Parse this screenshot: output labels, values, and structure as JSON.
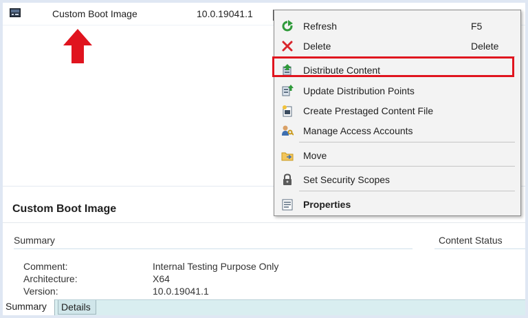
{
  "list": {
    "row": {
      "name": "Custom Boot Image",
      "version": "10.0.19041.1"
    }
  },
  "context_menu": {
    "items": [
      {
        "label": "Refresh",
        "shortcut": "F5",
        "icon": "refresh-icon"
      },
      {
        "label": "Delete",
        "shortcut": "Delete",
        "icon": "delete-icon"
      },
      {
        "label": "Distribute Content",
        "icon": "distribute-content-icon",
        "highlighted": true
      },
      {
        "label": "Update Distribution Points",
        "icon": "update-distribution-points-icon"
      },
      {
        "label": "Create Prestaged Content File",
        "icon": "prestaged-content-icon"
      },
      {
        "label": "Manage Access Accounts",
        "icon": "access-accounts-icon"
      },
      {
        "label": "Move",
        "icon": "folder-move-icon"
      },
      {
        "label": "Set Security Scopes",
        "icon": "lock-icon"
      },
      {
        "label": "Properties",
        "icon": "properties-icon"
      }
    ]
  },
  "details": {
    "title": "Custom Boot Image",
    "summary_label": "Summary",
    "content_status_label": "Content Status",
    "properties": [
      {
        "label": "Comment:",
        "value": "Internal Testing Purpose Only"
      },
      {
        "label": "Architecture:",
        "value": "X64"
      },
      {
        "label": "Version:",
        "value": "10.0.19041.1"
      }
    ],
    "tabs": [
      {
        "label": "Summary"
      },
      {
        "label": "Details"
      }
    ]
  },
  "colors": {
    "highlight": "#e0141e",
    "menu_background": "#f3f3f3",
    "tab_strip": "#d9eef0"
  }
}
